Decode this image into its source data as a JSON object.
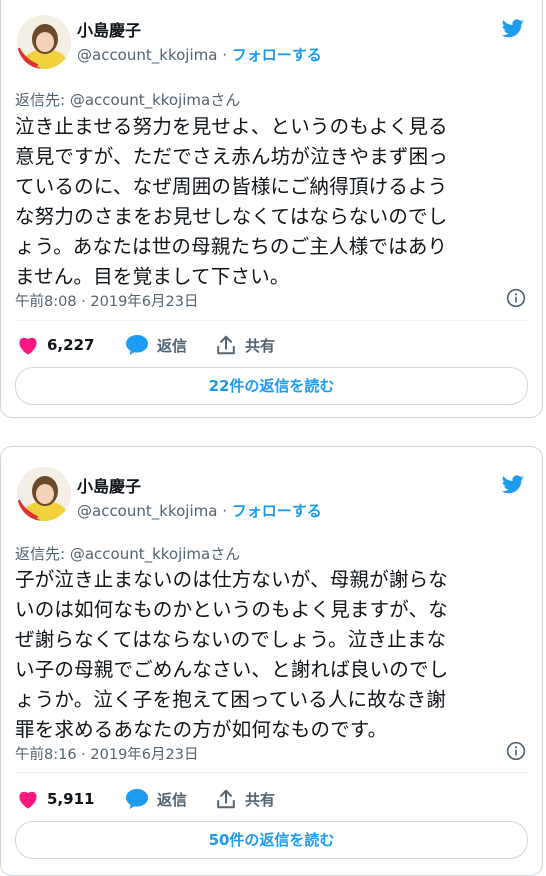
{
  "tweets": [
    {
      "author_name": "小島慶子",
      "handle": "@account_kkojima",
      "separator": " · ",
      "follow_label": "フォローする",
      "reply_to_prefix": "返信先: ",
      "reply_to_handle": "@account_kkojima",
      "reply_to_suffix": "さん",
      "text": "泣き止ませる努力を見せよ、というのもよく見る\n意見ですが、ただでさえ赤ん坊が泣きやまず困っ\nているのに、なぜ周囲の皆様にご納得頂けるよう\nな努力のさまをお見せしなくてはならないのでし\nょう。あなたは世の母親たちのご主人様ではあり\nません。目を覚まして下さい。",
      "timestamp": "午前8:08 · 2019年6月23日",
      "likes": "6,227",
      "reply_label": "返信",
      "share_label": "共有",
      "read_replies_label": "22件の返信を読む"
    },
    {
      "author_name": "小島慶子",
      "handle": "@account_kkojima",
      "separator": " · ",
      "follow_label": "フォローする",
      "reply_to_prefix": "返信先: ",
      "reply_to_handle": "@account_kkojima",
      "reply_to_suffix": "さん",
      "text": "子が泣き止まないのは仕方ないが、母親が謝らな\nいのは如何なものかというのもよく見ますが、な\nぜ謝らなくてはならないのでしょう。泣き止まな\nい子の母親でごめんなさい、と謝れば良いのでし\nょうか。泣く子を抱えて困っている人に故なき謝\n罪を求めるあなたの方が如何なものです。",
      "timestamp": "午前8:16 · 2019年6月23日",
      "likes": "5,911",
      "reply_label": "返信",
      "share_label": "共有",
      "read_replies_label": "50件の返信を読む"
    }
  ],
  "colors": {
    "accent": "#1d9bf0",
    "like": "#f91880",
    "secondary_text": "#536471",
    "border": "#cfd9de"
  },
  "icons": [
    "twitter-bird-icon",
    "info-icon",
    "heart-icon",
    "reply-bubble-icon",
    "share-icon",
    "avatar"
  ]
}
